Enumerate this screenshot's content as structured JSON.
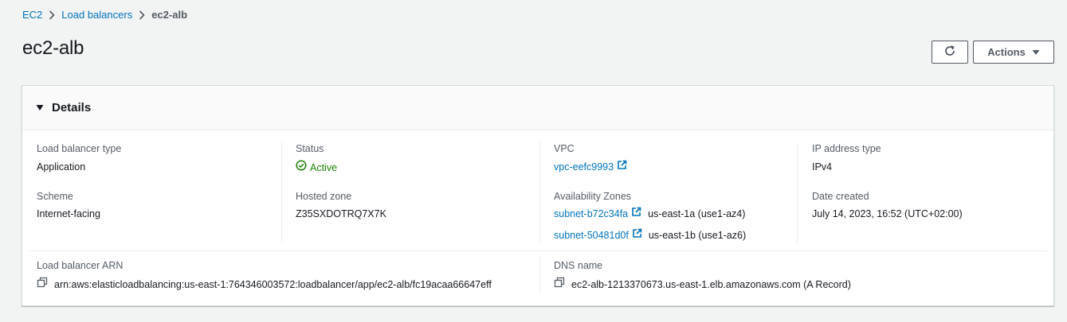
{
  "breadcrumb": {
    "items": [
      "EC2",
      "Load balancers"
    ],
    "current": "ec2-alb"
  },
  "page": {
    "title": "ec2-alb"
  },
  "header": {
    "actions_label": "Actions"
  },
  "details": {
    "title": "Details",
    "lb_type_label": "Load balancer type",
    "lb_type_value": "Application",
    "scheme_label": "Scheme",
    "scheme_value": "Internet-facing",
    "status_label": "Status",
    "status_value": "Active",
    "hosted_zone_label": "Hosted zone",
    "hosted_zone_value": "Z35SXDOTRQ7X7K",
    "vpc_label": "VPC",
    "vpc_value": "vpc-eefc9993",
    "az_label": "Availability Zones",
    "az_1_subnet": "subnet-b72c34fa",
    "az_1_zone": "us-east-1a (use1-az4)",
    "az_2_subnet": "subnet-50481d0f",
    "az_2_zone": "us-east-1b (use1-az6)",
    "ip_type_label": "IP address type",
    "ip_type_value": "IPv4",
    "date_label": "Date created",
    "date_value": "July 14, 2023, 16:52 (UTC+02:00)",
    "arn_label": "Load balancer ARN",
    "arn_value": "arn:aws:elasticloadbalancing:us-east-1:764346003572:loadbalancer/app/ec2-alb/fc19acaa66647eff",
    "dns_label": "DNS name",
    "dns_value": "ec2-alb-1213370673.us-east-1.elb.amazonaws.com (A Record)"
  },
  "colors": {
    "link": "#0073bb",
    "active": "#1d8102",
    "background": "#f2f3f3",
    "text": "#16191f",
    "muted": "#545b64"
  },
  "icons": [
    "chevron-right-icon",
    "refresh-icon",
    "caret-down-icon",
    "caret-down-expand-icon",
    "check-circle-icon",
    "external-link-icon",
    "copy-icon"
  ]
}
